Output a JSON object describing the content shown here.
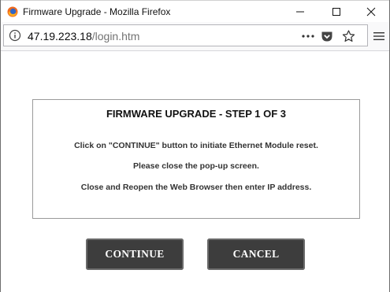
{
  "window": {
    "title": "Firmware Upgrade - Mozilla Firefox"
  },
  "urlbar": {
    "host": "47.19.223.18",
    "path": "/login.htm"
  },
  "dialog": {
    "title": "FIRMWARE UPGRADE - STEP 1 OF 3",
    "lines": [
      "Click on \"CONTINUE\" button to initiate Ethernet Module reset.",
      "Please close the pop-up screen.",
      "Close and Reopen the Web Browser then enter IP address."
    ]
  },
  "buttons": {
    "continue_label": "CONTINUE",
    "cancel_label": "CANCEL"
  },
  "icons": {
    "app": "firefox-icon",
    "info": "info-icon",
    "more": "page-actions-icon",
    "pocket": "pocket-icon",
    "bookmark": "star-icon",
    "menu": "hamburger-menu-icon"
  },
  "colors": {
    "button_bg": "#3d3d3d",
    "button_text": "#ffffff"
  }
}
